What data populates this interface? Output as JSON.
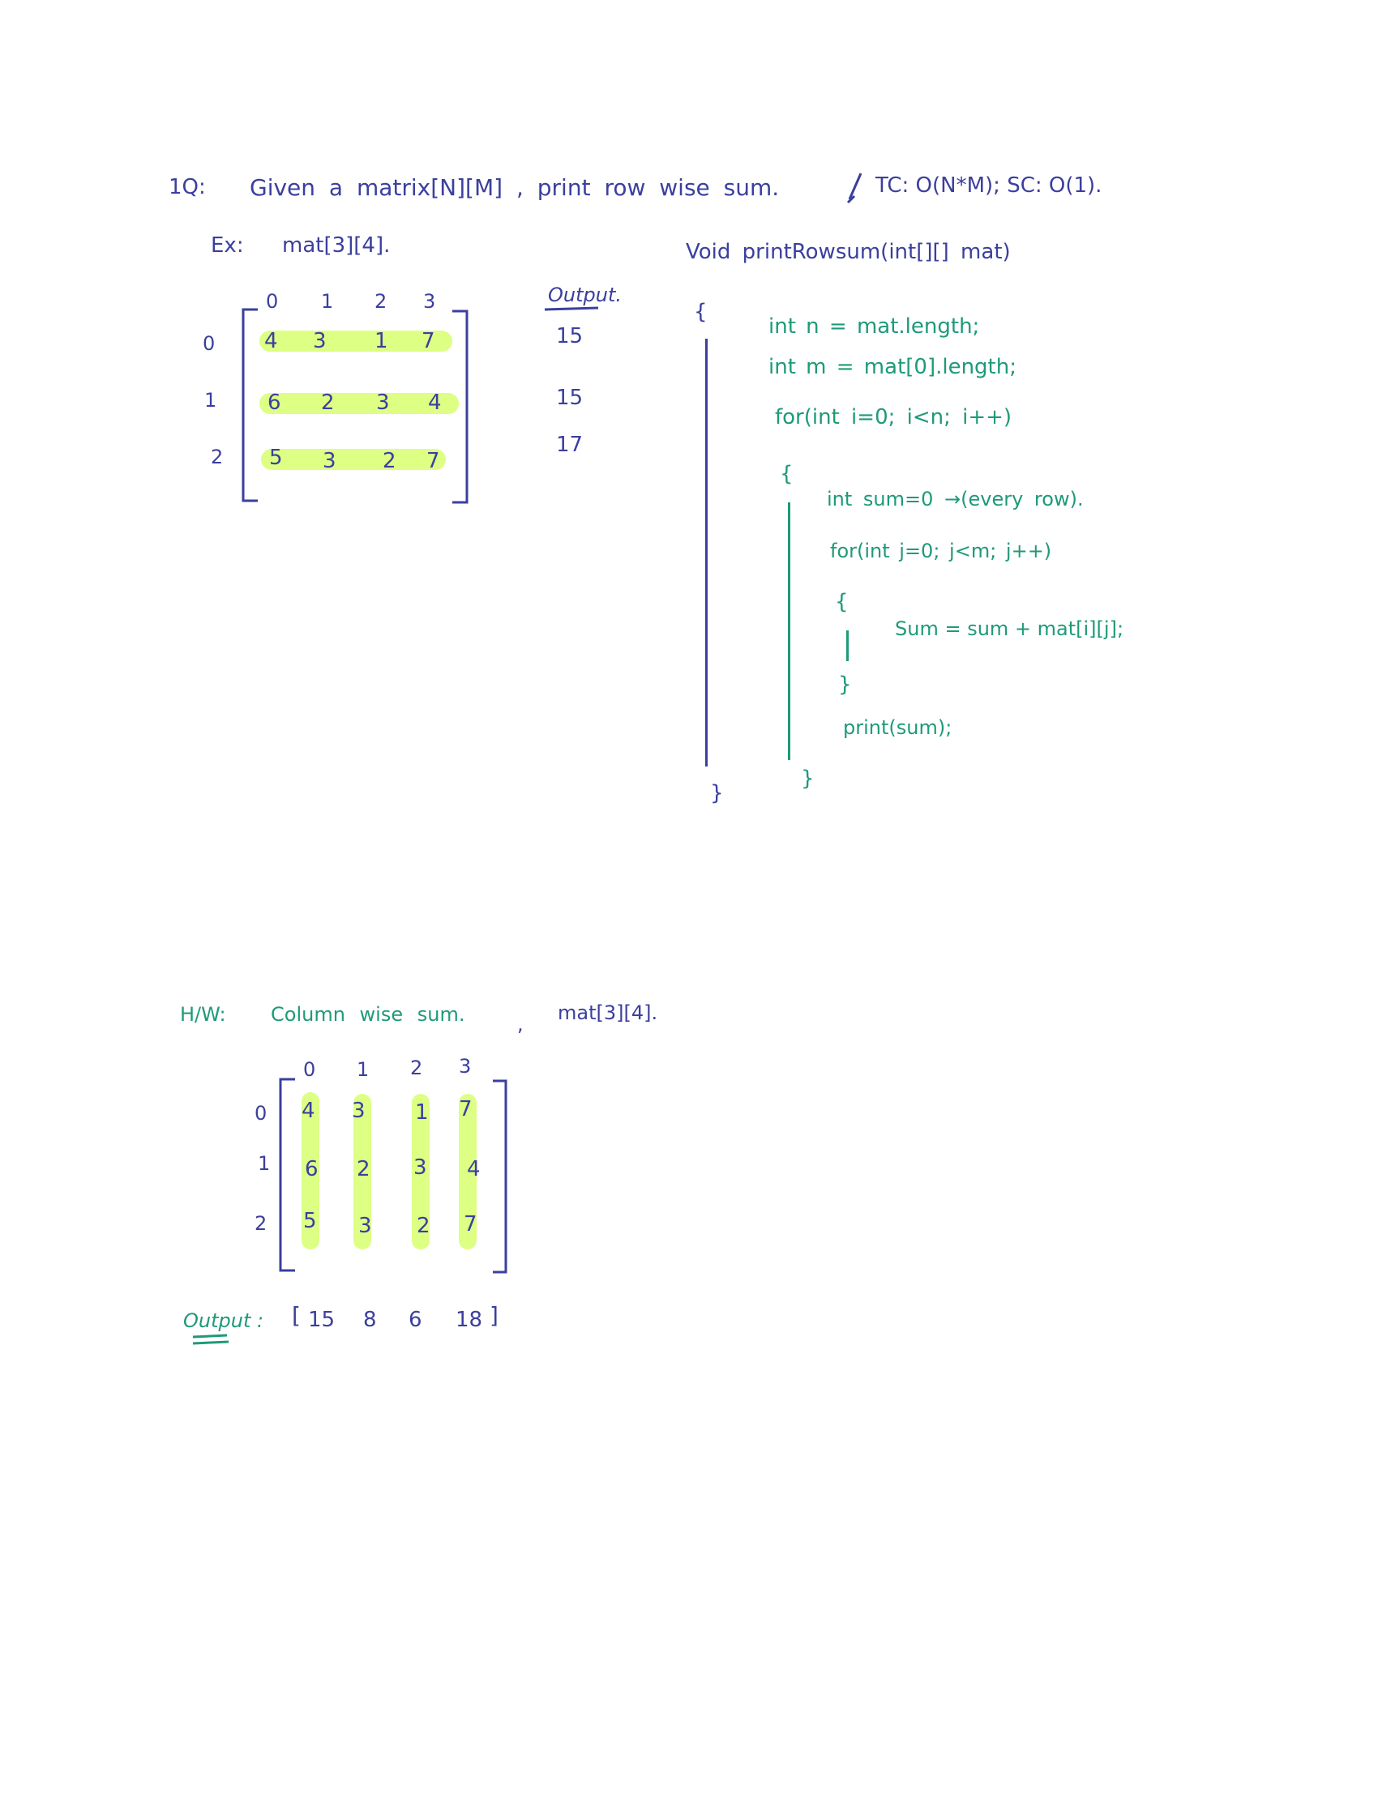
{
  "question": {
    "number": "1Q:",
    "text": "Given a matrix[N][M] , print row wise sum.",
    "complexity": "TC: O(N*M); SC: O(1)."
  },
  "example": {
    "label": "Ex:",
    "text": "mat[3][4]."
  },
  "matrix1": {
    "col_indices": [
      "0",
      "1",
      "2",
      "3"
    ],
    "row_indices": [
      "0",
      "1",
      "2"
    ],
    "rows": [
      [
        "4",
        "3",
        "1",
        "7"
      ],
      [
        "6",
        "2",
        "3",
        "4"
      ],
      [
        "5",
        "3",
        "2",
        "7"
      ]
    ]
  },
  "output1": {
    "label": "Output.",
    "values": [
      "15",
      "15",
      "17"
    ]
  },
  "code": {
    "signature": "Void printRowsum(int[][] mat)",
    "open_brace": "{",
    "line_n": "int n = mat.length;",
    "line_m": "int m = mat[0].length;",
    "outer_for": "for(int i=0; i<n; i++)",
    "outer_open": "{",
    "sum_init": "int sum=0 →(every row).",
    "inner_for": "for(int j=0; j<m; j++)",
    "inner_open": "{",
    "sum_update": "Sum = sum + mat[i][j];",
    "inner_close": "}",
    "print": "print(sum);",
    "outer_close": "}",
    "close_brace": "}"
  },
  "homework": {
    "label": "H/W:",
    "text": "Column wise sum.",
    "separator": ",",
    "mat": "mat[3][4]."
  },
  "matrix2": {
    "col_indices": [
      "0",
      "1",
      "2",
      "3"
    ],
    "row_indices": [
      "0",
      "1",
      "2"
    ],
    "rows": [
      [
        "4",
        "3",
        "1",
        "7"
      ],
      [
        "6",
        "2",
        "3",
        "4"
      ],
      [
        "5",
        "3",
        "2",
        "7"
      ]
    ]
  },
  "output2": {
    "label": "Output :",
    "open": "[",
    "values": [
      "15",
      "8",
      "6",
      "18"
    ],
    "close": "]"
  },
  "colors": {
    "blue_ink": "#3b3f9e",
    "green_ink": "#1e9a79",
    "highlight": "#d6ff6f"
  }
}
